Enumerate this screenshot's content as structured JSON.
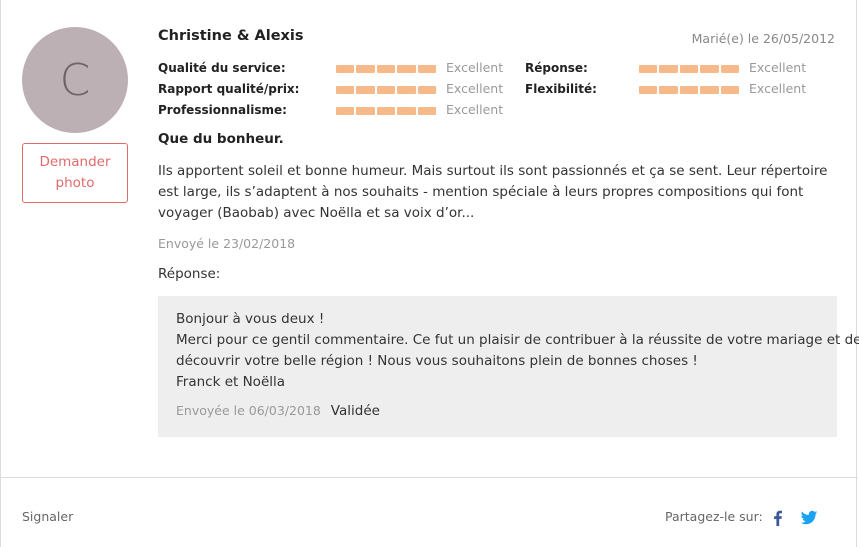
{
  "review": {
    "avatar_letter": "C",
    "photo_button": "Demander photo",
    "author": "Christine & Alexis",
    "wedding_date": "Marié(e) le 26/05/2012",
    "ratings_left": [
      {
        "label": "Qualité du service:",
        "value": "Excellent",
        "score": 5,
        "max": 5
      },
      {
        "label": "Rapport qualité/prix:",
        "value": "Excellent",
        "score": 5,
        "max": 5
      },
      {
        "label": "Professionnalisme:",
        "value": "Excellent",
        "score": 5,
        "max": 5
      }
    ],
    "ratings_right": [
      {
        "label": "Réponse:",
        "value": "Excellent",
        "score": 5,
        "max": 5
      },
      {
        "label": "Flexibilité:",
        "value": "Excellent",
        "score": 5,
        "max": 5
      }
    ],
    "title": "Que du bonheur.",
    "body": "Ils apportent soleil et bonne humeur. Mais surtout ils sont passionnés et ça se sent. Leur répertoire est large, ils s’adaptent à nos souhaits - mention spéciale à leurs propres compositions qui font voyager (Baobab) avec Noëlla et sa voix d’or...",
    "sent_date": "Envoyé le 23/02/2018"
  },
  "reply": {
    "label": "Réponse:",
    "lines": [
      "Bonjour à vous deux !",
      "Merci pour ce gentil commentaire. Ce fut un plaisir de contribuer à la réussite de votre mariage et de",
      "découvrir votre belle région ! Nous vous souhaitons plein de bonnes choses !",
      "Franck et Noëlla"
    ],
    "date": "Envoyée le 06/03/2018",
    "status": "Validée"
  },
  "footer": {
    "report": "Signaler",
    "share_label": "Partagez-le sur:",
    "share_icons": [
      "facebook-icon",
      "twitter-icon"
    ]
  },
  "colors": {
    "accent": "#e16a6a",
    "rating_bar": "#f6b989",
    "avatar_bg": "#bdb0b5",
    "facebook": "#3b5998",
    "twitter": "#1da1f2"
  }
}
